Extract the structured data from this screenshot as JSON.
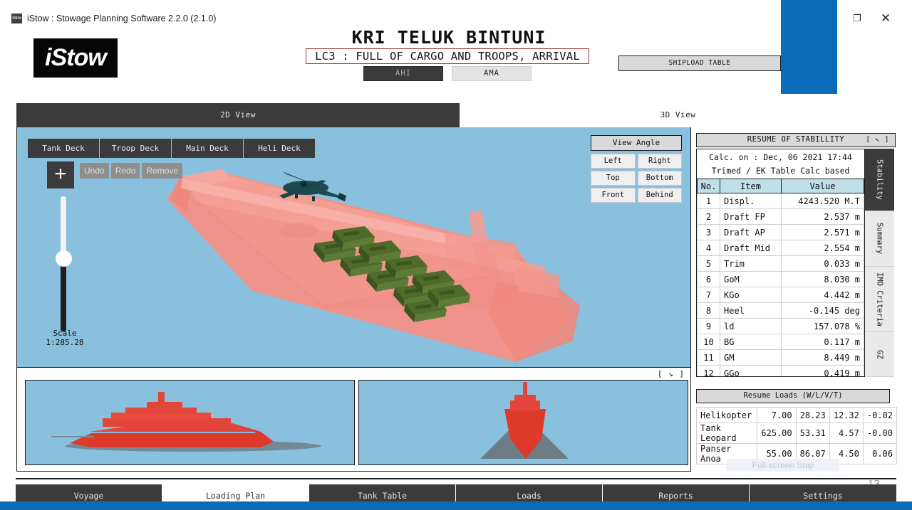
{
  "window": {
    "app_icon": "istow-app-icon",
    "title": "iStow : Stowage Planning Software 2.2.0 (2.1.0)",
    "maximize_icon": "❐",
    "close_icon": "✕"
  },
  "header": {
    "logo_text": "iStow",
    "ship_name": "KRI TELUK BINTUNI",
    "load_case": "LC3 : FULL OF CARGO AND TROOPS, ARRIVAL",
    "ahi_label": "AHI",
    "ama_label": "AMA",
    "shipload_table_label": "SHIPLOAD TABLE"
  },
  "view_tabs": [
    {
      "label": "2D View",
      "active": true
    },
    {
      "label": "3D View",
      "active": false
    }
  ],
  "deck_tabs": [
    {
      "label": "Tank Deck"
    },
    {
      "label": "Troop Deck"
    },
    {
      "label": "Main Deck"
    },
    {
      "label": "Heli Deck"
    }
  ],
  "edit_controls": {
    "add_icon": "+",
    "undo_label": "Undo",
    "redo_label": "Redo",
    "remove_label": "Remove"
  },
  "scale": {
    "label": "Scale",
    "value": "1:285.28"
  },
  "view_angle": {
    "title": "View Angle",
    "buttons": [
      "Left",
      "Right",
      "Top",
      "Bottom",
      "Front",
      "Behind"
    ]
  },
  "split_view": {
    "expand_icon": "[ ↘ ]"
  },
  "stability": {
    "panel_title": "RESUME OF STABILLITY",
    "panel_corner_icon": "[ ↖ ]",
    "calc_line1": "Calc. on : Dec, 06 2021 17:44",
    "calc_line2": "Trimed / EK Table Calc based",
    "columns": [
      "No.",
      "Item",
      "Value"
    ],
    "rows": [
      {
        "no": "1",
        "item": "Displ.",
        "value": "4243.520 M.T"
      },
      {
        "no": "2",
        "item": "Draft FP",
        "value": "2.537 m"
      },
      {
        "no": "3",
        "item": "Draft AP",
        "value": "2.571 m"
      },
      {
        "no": "4",
        "item": "Draft Mid",
        "value": "2.554 m"
      },
      {
        "no": "5",
        "item": "Trim",
        "value": "0.033 m"
      },
      {
        "no": "6",
        "item": "GoM",
        "value": "8.030 m"
      },
      {
        "no": "7",
        "item": "KGo",
        "value": "4.442 m"
      },
      {
        "no": "8",
        "item": "Heel",
        "value": "-0.145 deg"
      },
      {
        "no": "9",
        "item": "ld",
        "value": "157.078 %"
      },
      {
        "no": "10",
        "item": "BG",
        "value": "0.117 m"
      },
      {
        "no": "11",
        "item": "GM",
        "value": "8.449 m"
      },
      {
        "no": "12",
        "item": "GGo",
        "value": "0.419 m"
      }
    ]
  },
  "side_tabs": [
    {
      "label": "Stability",
      "active": true
    },
    {
      "label": "Summary",
      "active": false
    },
    {
      "label": "IMO Criteria",
      "active": false
    },
    {
      "label": "GZ",
      "active": false
    }
  ],
  "resume_loads": {
    "title": "Resume Loads (W/L/V/T)",
    "rows": [
      {
        "name": "Helikopter",
        "w": "7.00",
        "l": "28.23",
        "v": "12.32",
        "t": "-0.02"
      },
      {
        "name": "Tank Leopard",
        "w": "625.00",
        "l": "53.31",
        "v": "4.57",
        "t": "-0.00"
      },
      {
        "name": "Panser Anoa",
        "w": "55.00",
        "l": "86.07",
        "v": "4.50",
        "t": "0.06"
      }
    ]
  },
  "snip_overlay_label": "Full-screen Snip",
  "page_number": "13",
  "bottom_nav": [
    {
      "label": "Voyage",
      "active": false
    },
    {
      "label": "Loading Plan",
      "active": true
    },
    {
      "label": "Tank Table",
      "active": false
    },
    {
      "label": "Loads",
      "active": false
    },
    {
      "label": "Reports",
      "active": false
    },
    {
      "label": "Settings",
      "active": false
    }
  ],
  "colors": {
    "accent_blue": "#0a6cb8",
    "dark_chrome": "#3b3b3b",
    "canvas_sky": "#89c0dd",
    "ship_hull": "#f08a80",
    "ship_solid_red": "#e03a2f",
    "table_header": "#bfdfe9",
    "warning_border": "#a03030"
  }
}
